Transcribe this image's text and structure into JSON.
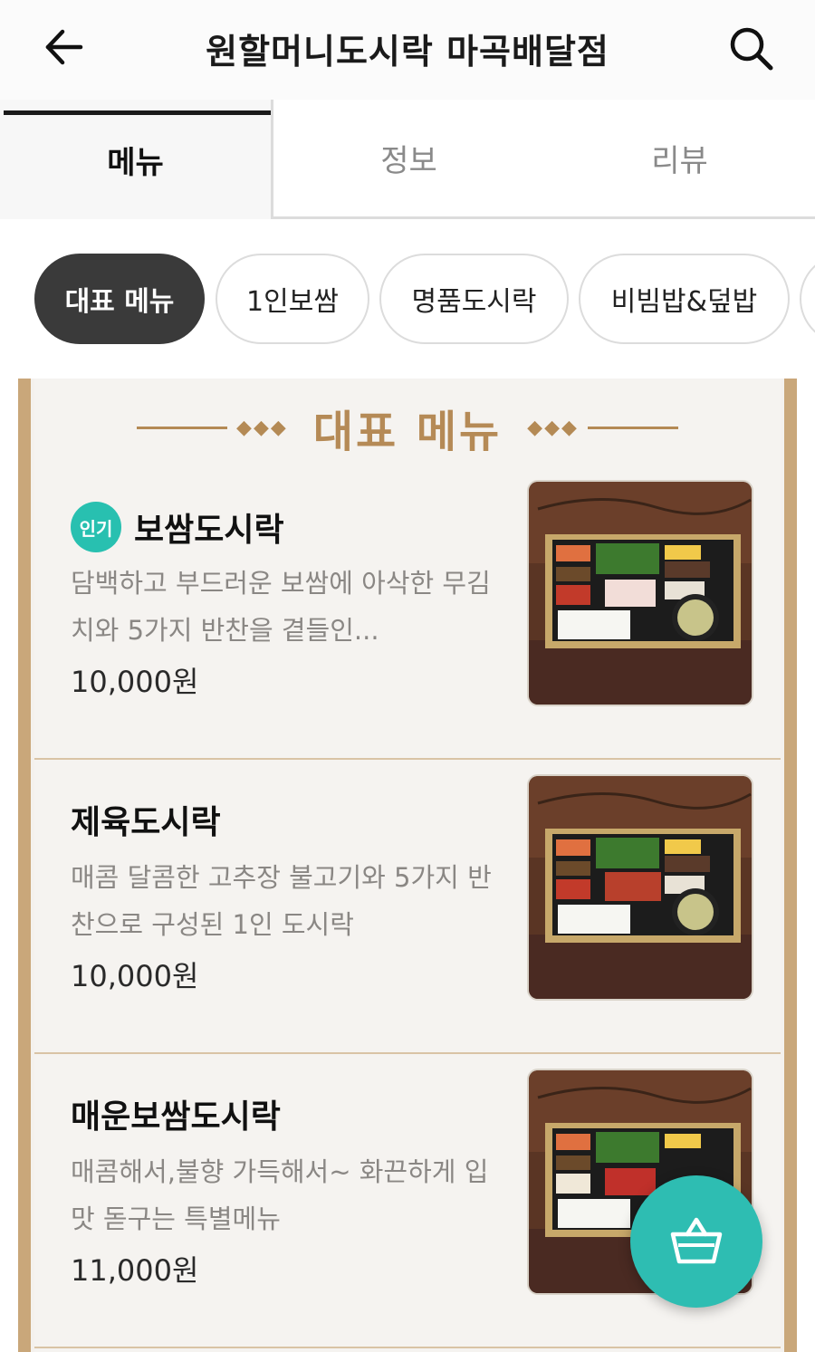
{
  "header": {
    "title": "원할머니도시락 마곡배달점",
    "back_icon": "arrow-left-icon",
    "search_icon": "search-icon"
  },
  "tabs": [
    {
      "label": "메뉴",
      "active": true
    },
    {
      "label": "정보",
      "active": false
    },
    {
      "label": "리뷰",
      "active": false
    }
  ],
  "categories": [
    {
      "label": "대표 메뉴",
      "active": true
    },
    {
      "label": "1인보쌈",
      "active": false
    },
    {
      "label": "명품도시락",
      "active": false
    },
    {
      "label": "비빔밥&덮밥",
      "active": false
    }
  ],
  "section": {
    "heading": "대표 메뉴"
  },
  "items": [
    {
      "badge": "인기",
      "name": "보쌈도시락",
      "description": "담백하고 부드러운 보쌈에 아삭한 무김치와 5가지 반찬을 곁들인...",
      "price": "10,000원"
    },
    {
      "badge": "",
      "name": "제육도시락",
      "description": "매콤 달콤한 고추장 불고기와 5가지 반찬으로 구성된 1인 도시락",
      "price": "10,000원"
    },
    {
      "badge": "",
      "name": "매운보쌈도시락",
      "description": "매콤해서,불향 가득해서~ 화끈하게 입맛 돋구는 특별메뉴",
      "price": "11,000원"
    }
  ],
  "cart": {
    "icon": "basket-icon"
  },
  "colors": {
    "accent": "#2ebdb2",
    "badge": "#28c0b0",
    "board_frame": "#c9a77a",
    "heading": "#b58a56",
    "active_chip": "#3a3a3a"
  }
}
